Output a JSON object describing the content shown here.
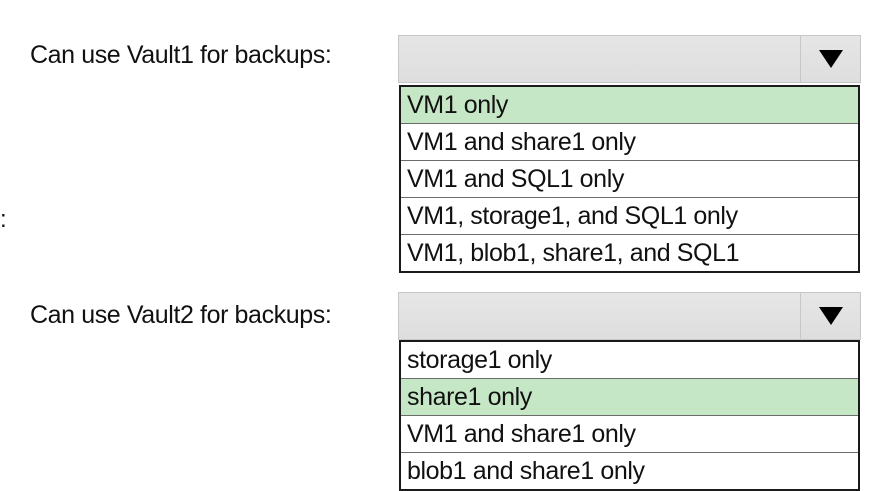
{
  "stray_text": ":",
  "questions": [
    {
      "label": "Can use Vault1 for backups:",
      "options": [
        {
          "text": "VM1 only",
          "selected": true
        },
        {
          "text": "VM1 and share1 only",
          "selected": false
        },
        {
          "text": "VM1 and SQL1 only",
          "selected": false
        },
        {
          "text": "VM1, storage1, and SQL1 only",
          "selected": false
        },
        {
          "text": "VM1, blob1, share1, and SQL1",
          "selected": false
        }
      ]
    },
    {
      "label": "Can use Vault2 for backups:",
      "options": [
        {
          "text": "storage1 only",
          "selected": false
        },
        {
          "text": "share1 only",
          "selected": true
        },
        {
          "text": "VM1 and share1 only",
          "selected": false
        },
        {
          "text": "blob1 and share1 only",
          "selected": false
        }
      ]
    }
  ],
  "icons": {
    "dropdown": "triangle-down-icon"
  },
  "colors": {
    "selected_option": "#c6e7c6",
    "dropdown_bg": "#e3e3e3"
  }
}
